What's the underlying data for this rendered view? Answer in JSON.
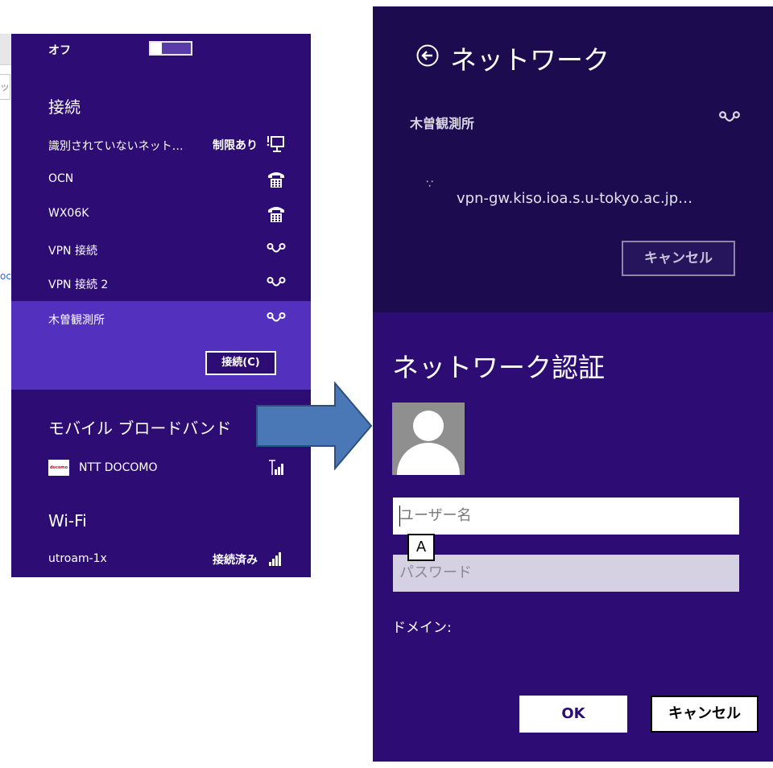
{
  "colors": {
    "panel_bg": "#2d0d74",
    "selected_bg": "#5430bf",
    "right_top_bg": "#1c0b4f",
    "arrow_fill": "#4a78b6",
    "arrow_stroke": "#2d4f7d"
  },
  "background_fragment": {
    "input_text": "ット",
    "link_text": "oc"
  },
  "left_panel": {
    "airplane_mode_state": "オフ",
    "connections_header": "接続",
    "connections": [
      {
        "name": "識別されていないネット…",
        "status": "制限あり",
        "icon": "network-limited-icon"
      },
      {
        "name": "OCN",
        "status": "",
        "icon": "dialup-phone-icon"
      },
      {
        "name": "WX06K",
        "status": "",
        "icon": "dialup-phone-icon"
      },
      {
        "name": "VPN 接続",
        "status": "",
        "icon": "vpn-icon"
      },
      {
        "name": "VPN 接続 2",
        "status": "",
        "icon": "vpn-icon"
      },
      {
        "name": "木曽観測所",
        "status": "",
        "icon": "vpn-icon",
        "selected": true
      }
    ],
    "connect_button": "接続(C)",
    "mobile_header": "モバイル ブロードバンド",
    "mobile_item": {
      "name": "NTT DOCOMO",
      "logo_text": "docomo",
      "icon": "mobile-signal-icon"
    },
    "wifi_header": "Wi-Fi",
    "wifi_item": {
      "name": "utroam-1x",
      "status": "接続済み",
      "icon": "wifi-signal-icon"
    }
  },
  "right_top": {
    "title": "ネットワーク",
    "network_name": "木曽観測所",
    "progress_dots": "∵",
    "server": "vpn-gw.kiso.ioa.s.u-tokyo.ac.jp…",
    "cancel_label": "キャンセル"
  },
  "right_bottom": {
    "title": "ネットワーク認証",
    "username_placeholder": "ユーザー名",
    "password_placeholder": "パスワード",
    "ime_indicator": "A",
    "domain_label": "ドメイン:",
    "ok_label": "OK",
    "cancel_label": "キャンセル"
  }
}
